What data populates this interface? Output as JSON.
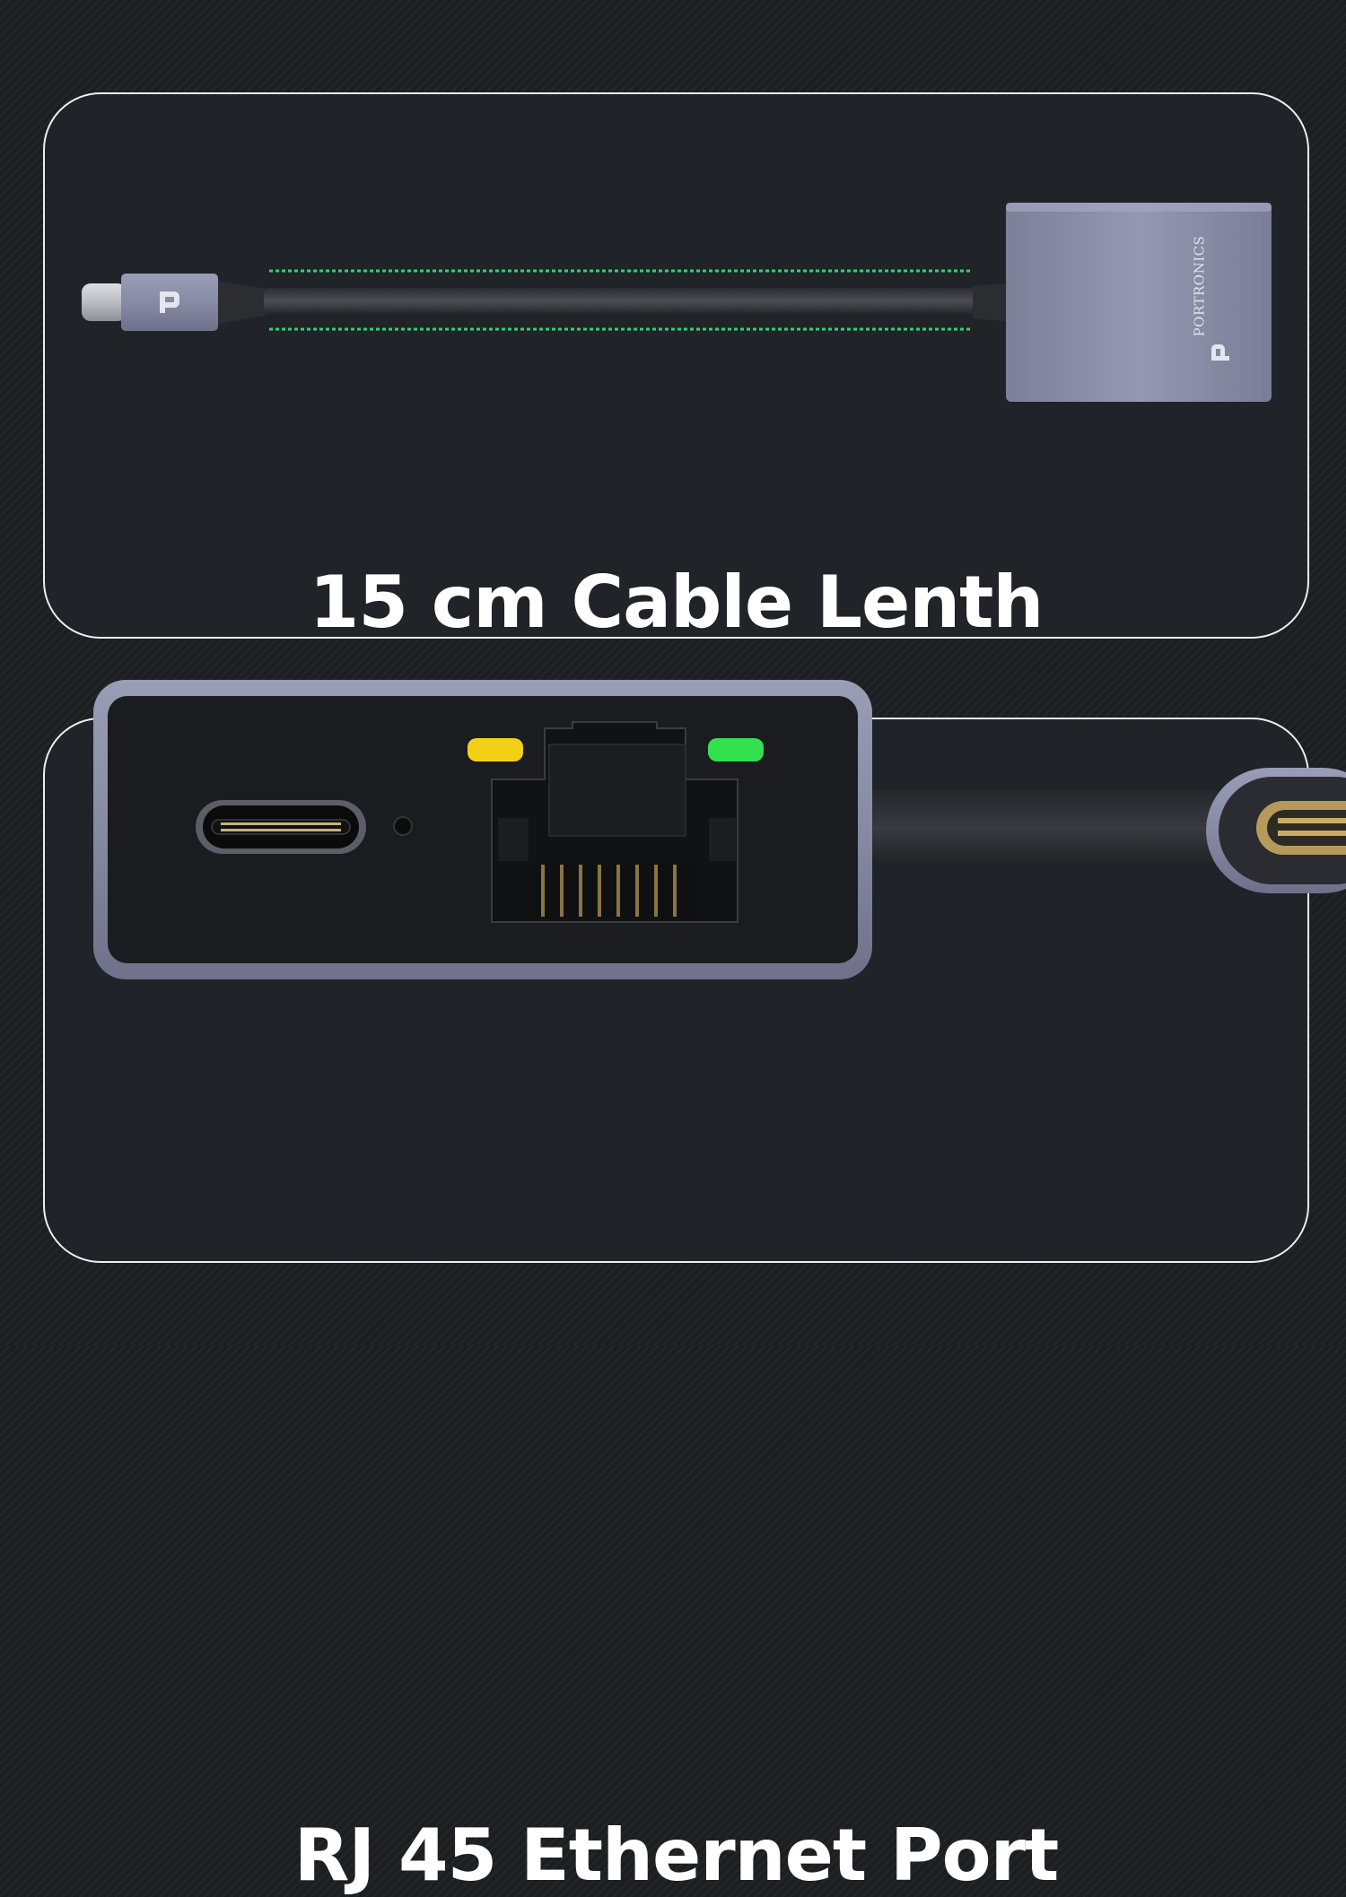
{
  "top_panel": {
    "caption": "15 cm Cable Lenth",
    "brand_on_device": "PORTRONICS",
    "measure_line_color": "#2fd27a"
  },
  "bottom_panel": {
    "caption": "RJ 45 Ethernet Port",
    "led_colors": {
      "left": "#f2d016",
      "right": "#35e04e"
    }
  },
  "colors": {
    "background": "#1c1e21",
    "panel": "#202327",
    "panel_border": "#eeeeee",
    "aluminium": "#8c8fa8"
  }
}
